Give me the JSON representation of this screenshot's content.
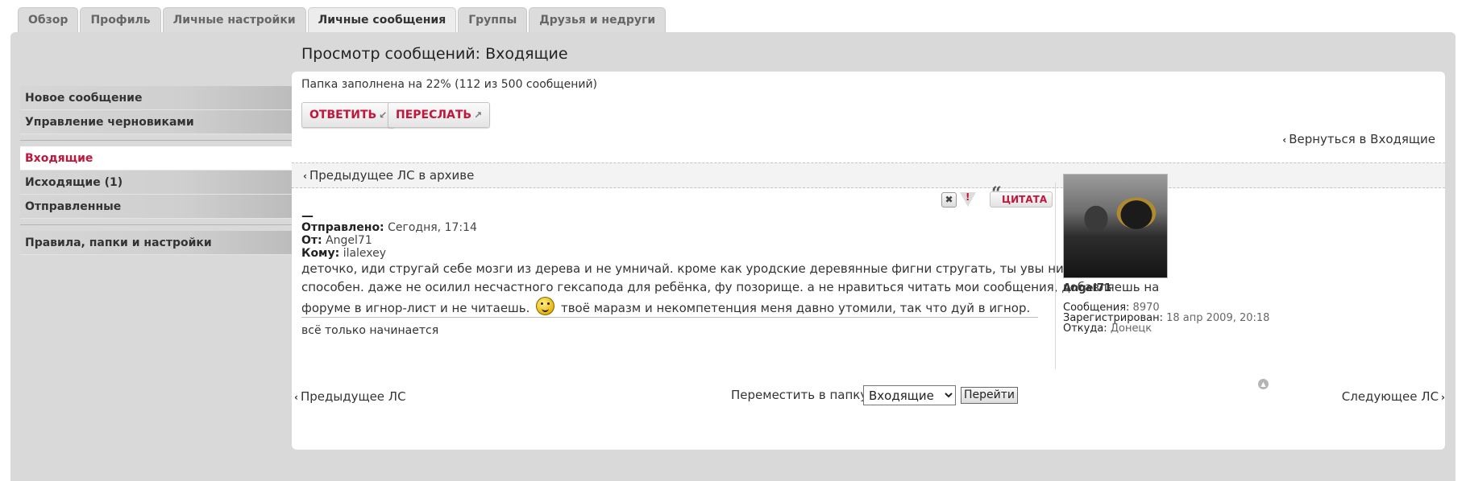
{
  "tabs": [
    {
      "label": "Обзор",
      "active": false
    },
    {
      "label": "Профиль",
      "active": false
    },
    {
      "label": "Личные настройки",
      "active": false
    },
    {
      "label": "Личные сообщения",
      "active": true
    },
    {
      "label": "Группы",
      "active": false
    },
    {
      "label": "Друзья и недруги",
      "active": false
    }
  ],
  "sidebar": {
    "groups": [
      [
        "Новое сообщение",
        "Управление черновиками"
      ],
      [
        "Входящие",
        "Исходящие (1)",
        "Отправленные"
      ],
      [
        "Правила, папки и настройки"
      ]
    ],
    "active_item": "Входящие"
  },
  "page_title": "Просмотр сообщений: Входящие",
  "folder_usage": "Папка заполнена на 22% (112 из 500 сообщений)",
  "folder_fill_percent": 22,
  "buttons": {
    "reply": "ОТВЕТИТЬ",
    "forward": "ПЕРЕСЛАТЬ",
    "quote": "ЦИТАТА"
  },
  "back_link": "Вернуться в Входящие",
  "prev_in_archive": "Предыдущее ЛС в архиве",
  "message": {
    "subject": "—",
    "sent_label": "Отправлено:",
    "sent_value": "Сегодня, 17:14",
    "from_label": "От:",
    "from_value": "Angel71",
    "to_label": "Кому:",
    "to_value": "ilalexey",
    "body_part1": "деточко, иди стругай себе мозги из дерева и не умничай. кроме как уродские деревянные фигни стругать, ты увы ни на что не способен. даже не осилил несчастного гексапода для ребёнка, фу позорище. а не нравиться читать мои сообщения, добавляешь на форуме в игнор-лист и не читаешь.",
    "body_part2": "твоё маразм и некомпетенция меня давно утомили, так что дуй в игнор.",
    "signature": "всё только начинается"
  },
  "author": {
    "username": "Angel71",
    "posts_label": "Сообщения:",
    "posts_value": "8970",
    "registered_label": "Зарегистрирован:",
    "registered_value": "18 апр 2009, 20:18",
    "location_label": "Откуда:",
    "location_value": "Донецк"
  },
  "bottom": {
    "prev": "Предыдущее ЛС",
    "next": "Следующее ЛС",
    "move_label": "Переместить в папку:",
    "folder_selected": "Входящие",
    "go": "Перейти"
  },
  "colors": {
    "accent": "#c0163c",
    "panel_bg": "#d9d9d9"
  },
  "icons": [
    "delete-icon",
    "report-icon",
    "quote-icon",
    "back-top-icon",
    "chevron-left-icon",
    "chevron-right-icon"
  ]
}
